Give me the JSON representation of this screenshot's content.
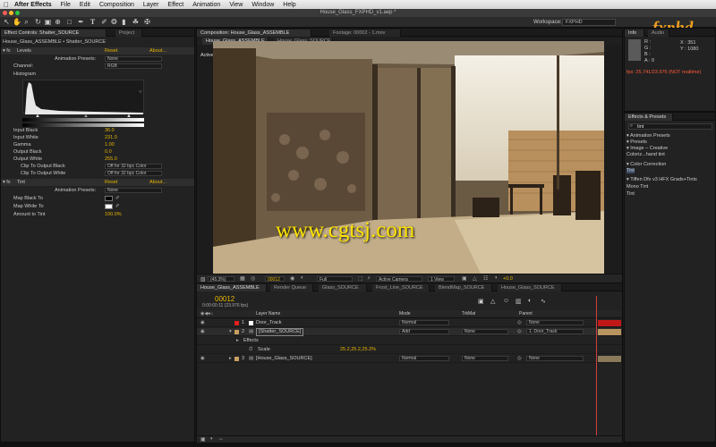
{
  "menubar": {
    "app": "After Effects",
    "items": [
      "File",
      "Edit",
      "Composition",
      "Layer",
      "Effect",
      "Animation",
      "View",
      "Window",
      "Help"
    ]
  },
  "window": {
    "title": "House_Glass_FXPHD_v1.aep *"
  },
  "toolbar": {
    "workspace_label": "Workspace:",
    "workspace_value": "FXPHD",
    "logo": "fxphd"
  },
  "effect_controls": {
    "tabs": [
      "Effect Controls: Shatter_SOURCE",
      "Project"
    ],
    "layer_path": "House_Glass_ASSEMBLE • Shatter_SOURCE",
    "levels": {
      "name": "Levels",
      "reset": "Reset",
      "about": "About...",
      "presets_label": "Animation Presets:",
      "presets_value": "None",
      "channel_label": "Channel:",
      "channel_value": "RGB",
      "histogram_label": "Histogram",
      "params": [
        {
          "label": "Input Black",
          "value": "36.0"
        },
        {
          "label": "Input White",
          "value": "231.0"
        },
        {
          "label": "Gamma",
          "value": "1.00"
        },
        {
          "label": "Output Black",
          "value": "0.0"
        },
        {
          "label": "Output White",
          "value": "255.0"
        }
      ],
      "clip_black_label": "Clip To Output Black",
      "clip_black_value": "Off for 32 bpc Color",
      "clip_white_label": "Clip To Output White",
      "clip_white_value": "Off for 32 bpc Color"
    },
    "tint": {
      "name": "Tint",
      "reset": "Reset",
      "about": "About...",
      "presets_label": "Animation Presets:",
      "presets_value": "None",
      "map_black_label": "Map Black To",
      "map_white_label": "Map White To",
      "amount_label": "Amount to Tint",
      "amount_value": "100.0%"
    }
  },
  "composition": {
    "tabs": [
      "Composition: House_Glass_ASSEMBLE",
      "Footage: 00002 - 1.mov"
    ],
    "sub_tabs": [
      "House_Glass_ASSEMBLE",
      "House_Glass_SOURCE"
    ],
    "view_label": "Active Camera",
    "bottom": {
      "zoom": "(45.3%)",
      "timecode": "00012",
      "resolution": "Full",
      "camera": "Active Camera",
      "views": "1 View",
      "exposure": "+0.0"
    }
  },
  "info": {
    "tabs": [
      "Info",
      "Audio"
    ],
    "r": "R :",
    "g": "G :",
    "b": "B :",
    "a": "A : 0",
    "x": "X : 351",
    "y": "Y : 1080",
    "fps": "fps: 25.741/23.976 (NOT realtime)"
  },
  "effects_presets": {
    "title": "Effects & Presets",
    "search": "tint",
    "rows": [
      "▾ Animation Presets",
      "   ▾ Presets",
      "      ▾ Image – Creative",
      "         Coloriz...hand tint",
      "▾ Color Correction",
      "      Tint",
      "▾ Tiffen Dfx v3 HFX Grads+Tints",
      "      Mono Tint",
      "      Tint"
    ]
  },
  "timeline": {
    "tabs": [
      "House_Glass_ASSEMBLE",
      "Render Queue",
      "Glass_SOURCE",
      "Frost_Line_SOURCE",
      "BlendMap_SOURCE",
      "House_Glass_SOURCE"
    ],
    "timecode": "00012",
    "timecode_sub": "0:00:00:11 (23.976 fps)",
    "columns": {
      "layer_name": "Layer Name",
      "mode": "Mode",
      "trkmat": "TrkMat",
      "parent": "Parent"
    },
    "layers": [
      {
        "num": "1",
        "name": "Door_Track",
        "mode": "Normal",
        "trkmat": "",
        "parent": "None",
        "color": "#e02020"
      },
      {
        "num": "2",
        "name": "[Shatter_SOURCE]",
        "mode": "Add",
        "trkmat": "None",
        "parent": "1. Door_Track",
        "color": "#c8a060"
      },
      {
        "num": "3",
        "name": "[House_Glass_SOURCE]",
        "mode": "Normal",
        "trkmat": "None",
        "parent": "None",
        "color": "#c8a060"
      }
    ],
    "effects_label": "Effects",
    "scale_label": "Scale",
    "scale_value": "25.2,25.2,25.2%"
  },
  "watermark": "www.cgtsj.com"
}
